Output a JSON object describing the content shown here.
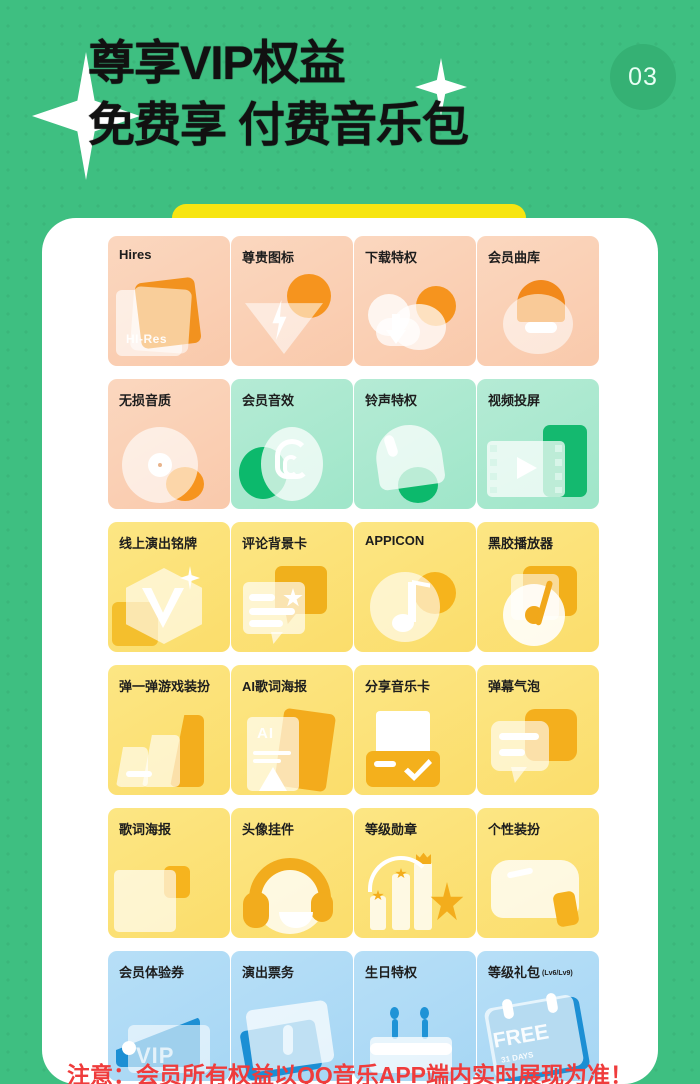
{
  "header": {
    "title_line_1": "尊享VIP权益",
    "title_line_2": "免费享 付费音乐包",
    "page_number": "03",
    "sparkle_large": "sparkle-icon",
    "sparkle_small": "sparkle-icon",
    "colors": {
      "background": "#3ebf81",
      "badge": "#35b174",
      "title_text": "#111111",
      "tab_accent": "#f7e511"
    }
  },
  "panel": {
    "background": "#ffffff",
    "rows": [
      {
        "tone": "peach",
        "cards": [
          {
            "label": "Hires",
            "art": "hires-albums",
            "badge_text": "HI-Res"
          },
          {
            "label": "尊贵图标",
            "art": "diamond-bolt"
          },
          {
            "label": "下载特权",
            "art": "cloud-download"
          },
          {
            "label": "会员曲库",
            "art": "song-library"
          }
        ]
      },
      {
        "tone": "mixed",
        "cards": [
          {
            "label": "无损音质",
            "tone": "peach",
            "art": "vinyl-disc"
          },
          {
            "label": "会员音效",
            "tone": "mint",
            "art": "ear-sound"
          },
          {
            "label": "铃声特权",
            "tone": "mint",
            "art": "bell-ringtone"
          },
          {
            "label": "视频投屏",
            "tone": "mint",
            "art": "video-cast"
          }
        ]
      },
      {
        "tone": "yellow",
        "cards": [
          {
            "label": "线上演出铭牌",
            "art": "medal-badge"
          },
          {
            "label": "评论背景卡",
            "art": "comment-card"
          },
          {
            "label": "APPICON",
            "art": "app-music-note"
          },
          {
            "label": "黑胶播放器",
            "art": "vinyl-player"
          }
        ]
      },
      {
        "tone": "yellow",
        "cards": [
          {
            "label": "弹一弹游戏装扮",
            "art": "game-skin"
          },
          {
            "label": "AI歌词海报",
            "art": "ai-lyric-poster",
            "badge_text": "AI"
          },
          {
            "label": "分享音乐卡",
            "art": "share-music-card"
          },
          {
            "label": "弹幕气泡",
            "art": "danmu-bubble"
          }
        ]
      },
      {
        "tone": "yellow",
        "cards": [
          {
            "label": "歌词海报",
            "art": "lyric-poster"
          },
          {
            "label": "头像挂件",
            "art": "avatar-headphones"
          },
          {
            "label": "等级勋章",
            "art": "level-medal-chart"
          },
          {
            "label": "个性装扮",
            "art": "personal-outfit"
          }
        ]
      },
      {
        "tone": "blue",
        "cards": [
          {
            "label": "会员体验券",
            "art": "vip-wallet",
            "badge_text": "VIP"
          },
          {
            "label": "演出票务",
            "art": "show-ticket"
          },
          {
            "label": "生日特权",
            "art": "birthday-cake"
          },
          {
            "label": "等级礼包",
            "sub_label": "(Lv6/Lv9)",
            "art": "free-gift-calendar",
            "badge_text": "FREE",
            "badge_sub": "31 DAYS"
          }
        ]
      }
    ],
    "palette": {
      "peach": "#fbd7bf",
      "mint": "#b5ebd5",
      "yellow": "#fce684",
      "blue": "#b7dff7",
      "accent_orange": "#f59526",
      "accent_green": "#0cb96c",
      "accent_blue": "#1c8fd4",
      "accent_yellow": "#f5c336"
    }
  },
  "footer": {
    "note": "注意：会员所有权益以QQ音乐APP端内实时展现为准！",
    "note_color": "#ef3c3c"
  }
}
